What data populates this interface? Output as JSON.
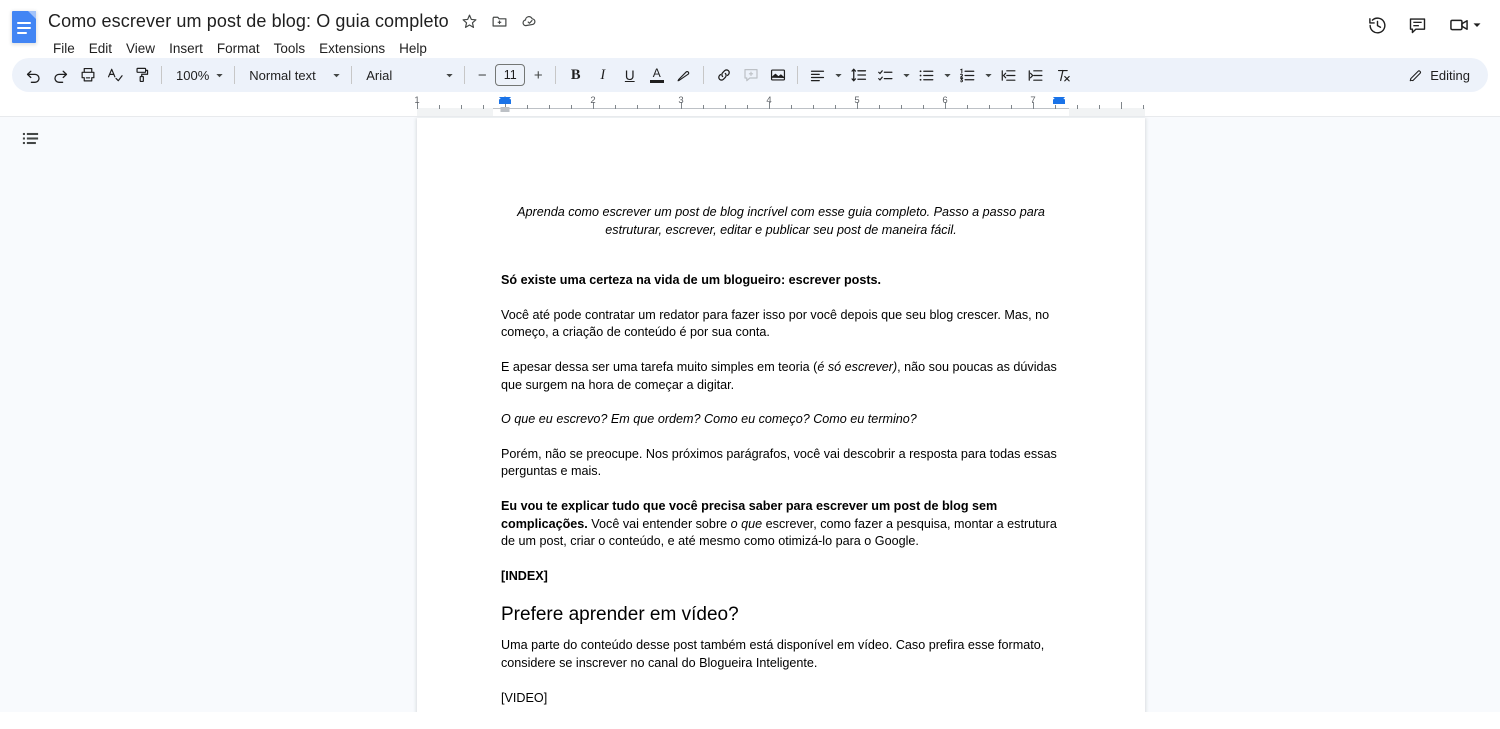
{
  "app": {
    "logo_icon": "google-docs-icon",
    "doc_title": "Como escrever um post de blog: O guia completo"
  },
  "title_icons": [
    {
      "name": "star-icon",
      "label": "Star"
    },
    {
      "name": "move-to-folder-icon",
      "label": "Move"
    },
    {
      "name": "cloud-saved-icon",
      "label": "Saved to Drive"
    }
  ],
  "menu": {
    "items": [
      "File",
      "Edit",
      "View",
      "Insert",
      "Format",
      "Tools",
      "Extensions",
      "Help"
    ]
  },
  "header_right": {
    "history_icon": "version-history-icon",
    "comments_icon": "comment-icon",
    "meet_icon": "video-camera-icon",
    "meet_caret": "chevron-down-icon"
  },
  "toolbar": {
    "undo": "undo-icon",
    "redo": "redo-icon",
    "print": "print-icon",
    "spellcheck": "spellcheck-icon",
    "paint_format": "paint-format-icon",
    "zoom_value": "100%",
    "style_value": "Normal text",
    "font_value": "Arial",
    "font_size_value": "11",
    "decrease_font_label": "−",
    "increase_font_label": "+",
    "bold_label": "B",
    "italic_label": "I",
    "underline_label": "U",
    "text_color_label": "A",
    "highlight": "highlight-pen-icon",
    "link": "insert-link-icon",
    "comment": "add-comment-icon",
    "image": "insert-image-icon",
    "align": "align-left-icon",
    "line_spacing": "line-spacing-icon",
    "checklist": "checklist-icon",
    "bulleted_list": "bulleted-list-icon",
    "numbered_list": "numbered-list-icon",
    "decrease_indent": "decrease-indent-icon",
    "increase_indent": "increase-indent-icon",
    "clear_formatting": "clear-formatting-icon",
    "editing_mode_label": "Editing",
    "editing_mode_icon": "pencil-icon"
  },
  "ruler": {
    "numbers": [
      "1",
      "1",
      "2",
      "3",
      "4",
      "5",
      "6",
      "7"
    ],
    "left_indent_in": 1.0,
    "right_indent_in": 6.5
  },
  "sidebar": {
    "outline_icon": "document-outline-icon"
  },
  "document": {
    "lead": "Aprenda como escrever um post de blog incrível com esse guia completo. Passo a passo para estruturar, escrever, editar e publicar seu post de maneira fácil.",
    "p1_bold": "Só existe uma certeza na vida de um blogueiro: escrever posts.",
    "p2": "Você até pode contratar um redator para fazer isso por você depois que seu blog crescer. Mas, no começo, a criação de conteúdo é por sua conta.",
    "p3_a": "E apesar dessa ser uma tarefa muito simples em teoria (",
    "p3_ital": "é só escrever)",
    "p3_b": ", não sou poucas as dúvidas que surgem na hora de começar a digitar.",
    "p4_ital": "O que eu escrevo? Em que ordem? Como eu começo? Como eu termino?",
    "p5": "Porém, não se preocupe. Nos próximos parágrafos, você vai descobrir a resposta para todas essas perguntas e mais.",
    "p6_bold": "Eu vou te explicar tudo que você precisa saber para escrever um post de blog sem complicações.",
    "p6_a": " Você vai entender sobre ",
    "p6_ital": "o que",
    "p6_b": " escrever, como fazer a pesquisa, montar a estrutura de um post, criar o conteúdo, e até mesmo como otimizá-lo para o Google.",
    "p7_bold": "[INDEX]",
    "h2": "Prefere aprender em vídeo?",
    "p8": "Uma parte do conteúdo desse post também está disponível em vídeo. Caso prefira esse formato, considere se inscrever no canal do Blogueira Inteligente.",
    "p9": "[VIDEO]"
  },
  "colors": {
    "brand_blue": "#4285f4",
    "toolbar_bg": "#edf2fa",
    "canvas_bg": "#f8fafd",
    "accent": "#1a73e8"
  }
}
